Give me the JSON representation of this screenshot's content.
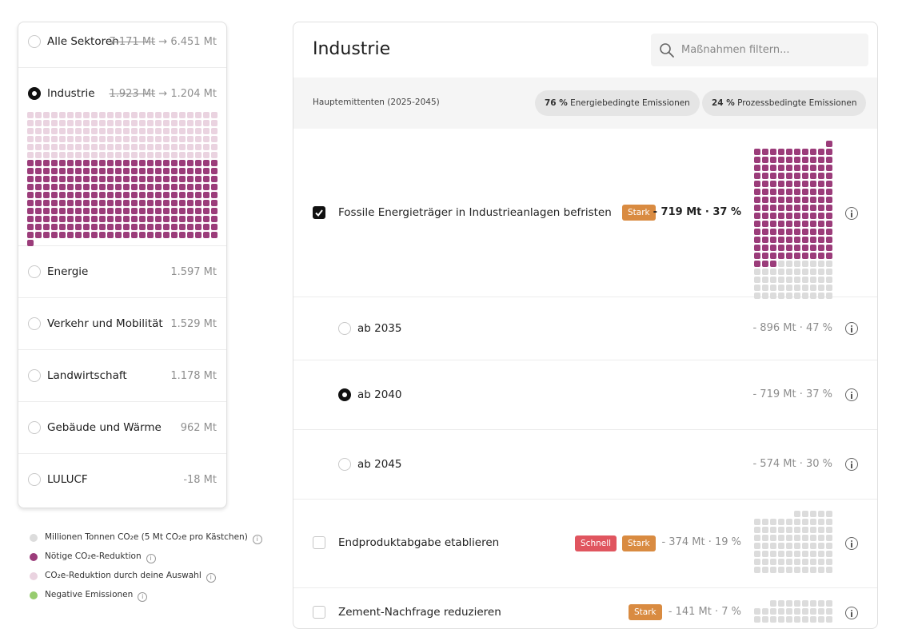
{
  "colors": {
    "needed_reduction": "#9b3c7a",
    "selected_reduction": "#ead3e0",
    "emissions": "#dcdcdc",
    "negative": "#97cc6f",
    "badge_stark": "#d98b41",
    "badge_schnell": "#e0555f"
  },
  "sidebar": {
    "items": [
      {
        "label": "Alle Sektoren",
        "old_value": "7.171 Mt",
        "arrow": "→",
        "value": "6.451 Mt",
        "selected": false
      },
      {
        "label": "Industrie",
        "old_value": "1.923 Mt",
        "arrow": "→",
        "value": "1.204 Mt",
        "selected": true
      },
      {
        "label": "Energie",
        "value": "1.597 Mt",
        "selected": false
      },
      {
        "label": "Verkehr und Mobilität",
        "value": "1.529 Mt",
        "selected": false
      },
      {
        "label": "Landwirtschaft",
        "value": "1.178 Mt",
        "selected": false
      },
      {
        "label": "Gebäude und Wärme",
        "value": "962 Mt",
        "selected": false
      },
      {
        "label": "LULUCF",
        "value": "-18 Mt",
        "selected": false
      }
    ],
    "industry_waffle": {
      "total_boxes": 385,
      "selected_reduction_boxes": 144,
      "needed_reduction_boxes": 241
    }
  },
  "legend": {
    "items": [
      {
        "label": "Millionen Tonnen CO₂e (5 Mt CO₂e pro Kästchen)",
        "swatch": "emissions"
      },
      {
        "label": "Nötige CO₂e-Reduktion",
        "swatch": "needed_reduction"
      },
      {
        "label": "CO₂e-Reduktion durch deine Auswahl",
        "swatch": "selected_reduction"
      },
      {
        "label": "Negative Emissionen",
        "swatch": "negative"
      }
    ],
    "info_glyph": "i"
  },
  "main": {
    "title": "Industrie",
    "search_placeholder": "Maßnahmen filtern...",
    "search_icon": "search-icon",
    "strip": {
      "label": "Hauptemittenten (2025-2045)",
      "chips": [
        {
          "percent": "76 %",
          "text": "Energiebedingte Emissionen"
        },
        {
          "percent": "24 %",
          "text": "Prozessbedingte Emissionen"
        }
      ]
    },
    "measures": [
      {
        "title": "Fossile Energieträger in Industrieanlagen befristen",
        "checked": true,
        "badges": [
          "Stark"
        ],
        "value": "- 719 Mt · 37 %",
        "waffle_boxes": 191,
        "waffle_highlight": 144
      },
      {
        "title": "Endproduktabgabe etablieren",
        "checked": false,
        "badges": [
          "Schnell",
          "Stark"
        ],
        "value": "- 374 Mt · 19 %",
        "waffle_boxes": 75
      },
      {
        "title": "Zement-Nachfrage reduzieren",
        "checked": false,
        "badges": [
          "Stark"
        ],
        "value": "- 141 Mt · 7 %",
        "waffle_boxes": 28
      }
    ],
    "options": [
      {
        "label": "ab 2035",
        "value": "- 896 Mt · 47 %",
        "selected": false
      },
      {
        "label": "ab 2040",
        "value": "- 719 Mt · 37 %",
        "selected": true
      },
      {
        "label": "ab 2045",
        "value": "- 574 Mt · 30 %",
        "selected": false
      }
    ]
  }
}
